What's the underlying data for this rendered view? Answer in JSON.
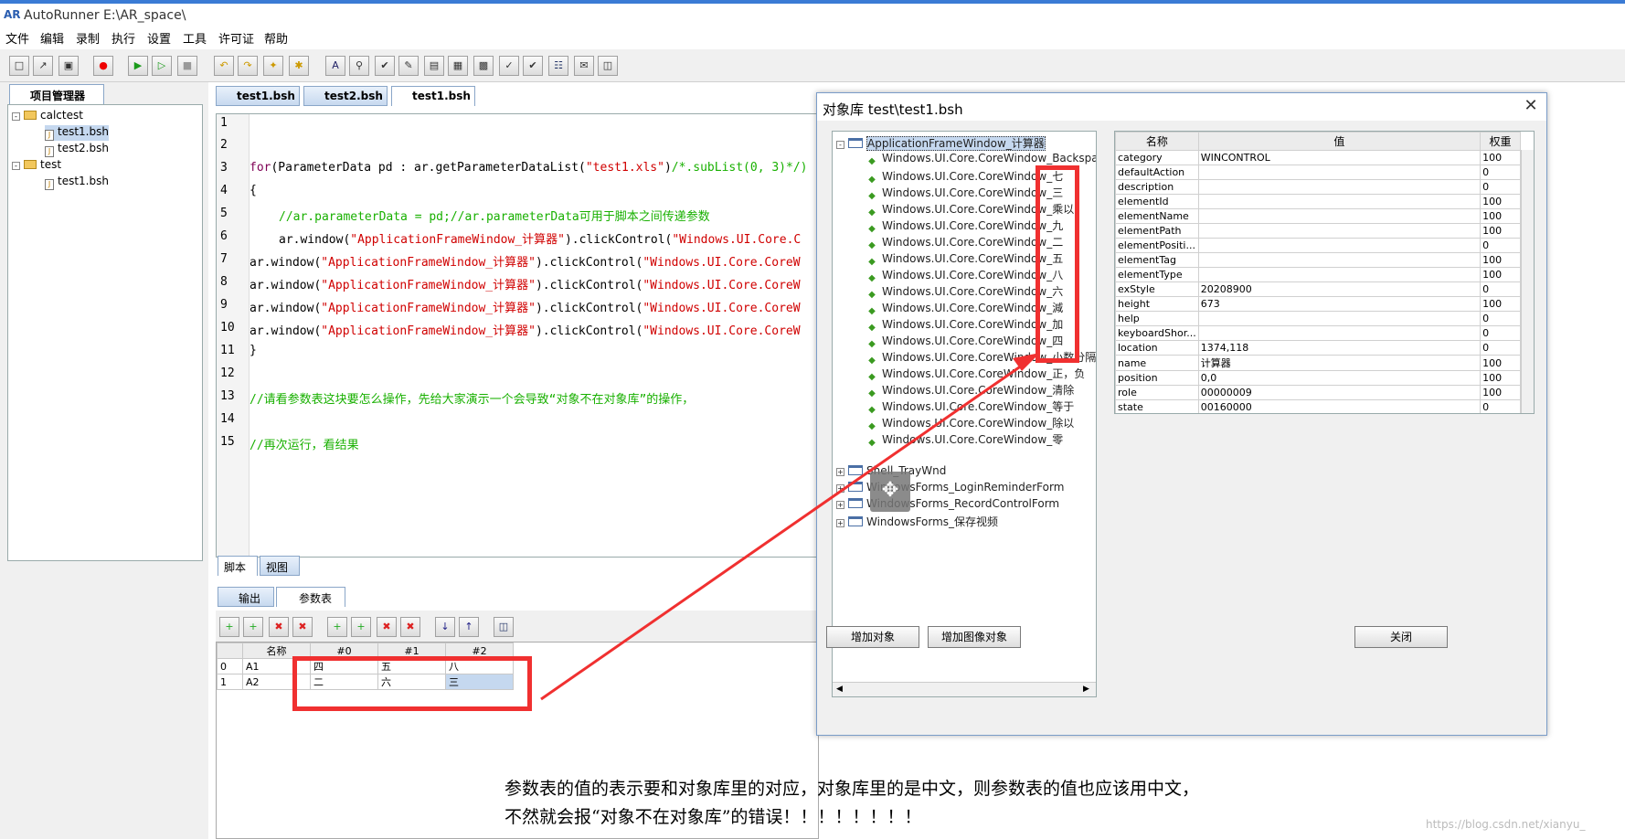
{
  "window": {
    "title": "AutoRunner  E:\\AR_space\\",
    "icon": "AR"
  },
  "menu": [
    "文件",
    "编辑",
    "录制",
    "执行",
    "设置",
    "工具",
    "许可证",
    "帮助"
  ],
  "project_panel": {
    "tab": "项目管理器",
    "tree": [
      {
        "label": "calctest",
        "type": "folder"
      },
      {
        "label": "test1.bsh",
        "type": "file",
        "selected": true
      },
      {
        "label": "test2.bsh",
        "type": "file"
      },
      {
        "label": "test",
        "type": "folder"
      },
      {
        "label": "test1.bsh",
        "type": "file"
      }
    ]
  },
  "editor_tabs": [
    "test1.bsh",
    "test2.bsh",
    "test1.bsh"
  ],
  "editor": {
    "line_numbers": [
      "1",
      "2",
      "3",
      "4",
      "5",
      "6",
      "7",
      "8",
      "9",
      "10",
      "11",
      "12",
      "13",
      "14",
      "15"
    ],
    "l3_for": "for",
    "l3_a": "(ParameterData pd : ar.getParameterDataList(",
    "l3_str": "\"test1.xls\"",
    "l3_b": ")",
    "l3_cmt": "/*.subList(0, 3)*/)",
    "l4": "{",
    "l5": "//ar.parameterData = pd;//ar.parameterData可用于脚本之间传递参数",
    "l6_a": "ar.window(",
    "l6_s": "\"ApplicationFrameWindow_计算器\"",
    "l6_b": ").clickControl(",
    "l6_s2": "\"Windows.UI.Core.C",
    "l_win": "ar.window(",
    "l_ws": "\"ApplicationFrameWindow_计算器\"",
    "l_click": ").clickControl(",
    "l_cs": "\"Windows.UI.Core.CoreW",
    "l11": "}",
    "l13": "//请看参数表这块要怎么操作，先给大家演示一个会导致“对象不在对象库”的操作，",
    "l15": "//再次运行，看结果"
  },
  "view_tabs": [
    "脚本",
    "视图"
  ],
  "output_tabs": [
    "输出",
    "参数表"
  ],
  "param_table": {
    "headers": [
      "",
      "名称",
      "#0",
      "#1",
      "#2"
    ],
    "rows": [
      [
        "0",
        "A1",
        "四",
        "五",
        "八"
      ],
      [
        "1",
        "A2",
        "二",
        "六",
        "三"
      ]
    ]
  },
  "dialog": {
    "title": "对象库  test\\test1.bsh",
    "close": "✕",
    "root": "ApplicationFrameWindow_计算器",
    "children": [
      "Windows.UI.Core.CoreWindow_Backspace",
      "Windows.UI.Core.CoreWindow_七",
      "Windows.UI.Core.CoreWindow_三",
      "Windows.UI.Core.CoreWindow_乘以",
      "Windows.UI.Core.CoreWindow_九",
      "Windows.UI.Core.CoreWindow_二",
      "Windows.UI.Core.CoreWindow_五",
      "Windows.UI.Core.CoreWindow_八",
      "Windows.UI.Core.CoreWindow_六",
      "Windows.UI.Core.CoreWindow_減",
      "Windows.UI.Core.CoreWindow_加",
      "Windows.UI.Core.CoreWindow_四",
      "Windows.UI.Core.CoreWindow_小数分隔符",
      "Windows.UI.Core.CoreWindow_正，负",
      "Windows.UI.Core.CoreWindow_清除",
      "Windows.UI.Core.CoreWindow_等于",
      "Windows.UI.Core.CoreWindow_除以",
      "Windows.UI.Core.CoreWindow_零"
    ],
    "others": [
      "Shell_TrayWnd",
      "WindowsForms_LoginReminderForm",
      "WindowsForms_RecordControlForm",
      "WindowsForms_保存视频"
    ],
    "prop_headers": [
      "名称",
      "值",
      "权重"
    ],
    "props": [
      [
        "category",
        "WINCONTROL",
        "100"
      ],
      [
        "defaultAction",
        "",
        "0"
      ],
      [
        "description",
        "",
        "0"
      ],
      [
        "elementId",
        "",
        "100"
      ],
      [
        "elementName",
        "",
        "100"
      ],
      [
        "elementPath",
        "",
        "100"
      ],
      [
        "elementPositi...",
        "",
        "0"
      ],
      [
        "elementTag",
        "",
        "100"
      ],
      [
        "elementType",
        "",
        "100"
      ],
      [
        "exStyle",
        "20208900",
        "0"
      ],
      [
        "height",
        "673",
        "100"
      ],
      [
        "help",
        "",
        "0"
      ],
      [
        "keyboardShor...",
        "",
        "0"
      ],
      [
        "location",
        "1374,118",
        "0"
      ],
      [
        "name",
        "计算器",
        "100"
      ],
      [
        "position",
        "0,0",
        "100"
      ],
      [
        "role",
        "00000009",
        "100"
      ],
      [
        "state",
        "00160000",
        "0"
      ]
    ],
    "buttons": {
      "add_object": "增加对象",
      "add_image": "增加图像对象",
      "close": "关闭"
    }
  },
  "caption": {
    "line1": "参数表的值的表示要和对象库里的对应，对象库里的是中文，则参数表的值也应该用中文，",
    "line2": "不然就会报“对象不在对象库”的错误！！！！！！！！"
  },
  "watermark": "https://blog.csdn.net/xianyu_",
  "colors": {
    "annotation_red": "#f03030",
    "keyword": "#7f0055",
    "string": "#d00000",
    "comment": "#18b000"
  }
}
